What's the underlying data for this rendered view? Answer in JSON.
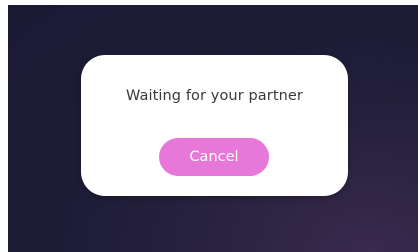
{
  "dialog": {
    "message": "Waiting for your partner",
    "cancel_label": "Cancel"
  },
  "colors": {
    "backdrop": "#1d1c37",
    "dialog_background": "#ffffff",
    "button_background": "#e777d8",
    "button_text": "#ffffff",
    "message_text": "#3a3a3a"
  }
}
